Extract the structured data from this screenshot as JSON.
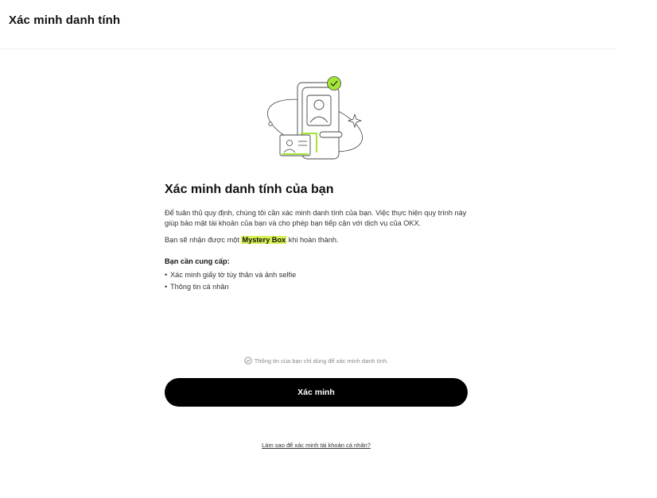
{
  "header": {
    "title": "Xác minh danh tính"
  },
  "illustration": {
    "icon": "id-verification-illustration",
    "accent_color": "#a3e635"
  },
  "main": {
    "title": "Xác minh danh tính của bạn",
    "description": "Để tuân thủ quy định, chúng tôi cần xác minh danh tính của bạn. Việc thực hiện quy trình này giúp bảo mật tài khoản của bạn và cho phép bạn tiếp cận với dịch vụ của OKX.",
    "reward_prefix": "Bạn sẽ nhận được một ",
    "reward_highlight": "Mystery Box",
    "reward_suffix": " khi hoàn thành.",
    "requirements_title": "Bạn cần cung cấp:",
    "requirements": [
      "Xác minh giấy tờ tùy thân và ảnh selfie",
      "Thông tin cá nhân"
    ]
  },
  "privacy_note": "Thông tin của bạn chỉ dùng để xác minh danh tính.",
  "verify_button": "Xác minh",
  "help_link": "Làm sao để xác minh tài khoản cá nhân?",
  "colors": {
    "button_bg": "#000000",
    "highlight": "#d6f255"
  }
}
